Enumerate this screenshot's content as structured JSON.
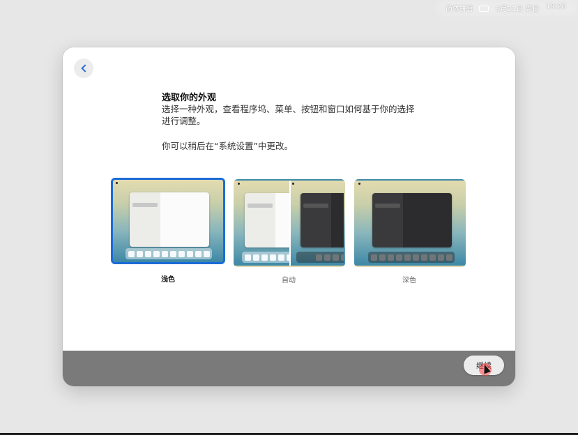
{
  "menubar": {
    "input_method": "简体拼音",
    "date": "9月21日 周日",
    "time": "19:28"
  },
  "window": {
    "back_icon": "chevron-left-icon",
    "title": "选取你的外观",
    "subtitle": "选择一种外观，查看程序坞、菜单、按钮和窗口如何基于你的选择进行调整。",
    "note": "你可以稍后在“系统设置”中更改。",
    "options": [
      {
        "label": "浅色",
        "selected": true
      },
      {
        "label": "自动",
        "selected": false
      },
      {
        "label": "深色",
        "selected": false
      }
    ],
    "continue_label": "继续"
  },
  "colors": {
    "accent": "#1b6bd8",
    "footer": "#7a7a7a",
    "window_bg": "#ffffff"
  }
}
